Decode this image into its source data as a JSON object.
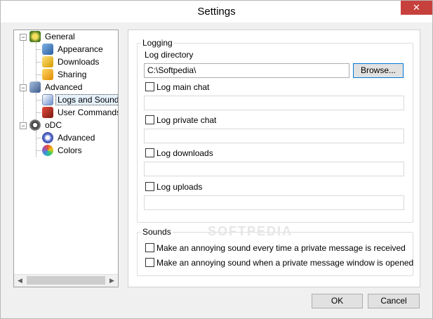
{
  "window": {
    "title": "Settings",
    "close_glyph": "✕"
  },
  "tree": {
    "items": [
      {
        "label": "General",
        "icon": "general-icon",
        "color": "#6b8e23"
      },
      {
        "label": "Appearance",
        "icon": "appearance-icon",
        "color": "#3a7bd5"
      },
      {
        "label": "Downloads",
        "icon": "downloads-icon",
        "color": "#e8b100"
      },
      {
        "label": "Sharing",
        "icon": "sharing-icon",
        "color": "#e8a000"
      },
      {
        "label": "Advanced",
        "icon": "advanced-icon",
        "color": "#4a6fa5"
      },
      {
        "label": "Logs and Sounds",
        "icon": "logs-icon",
        "color": "#3c64b4"
      },
      {
        "label": "User Commands",
        "icon": "user-commands-icon",
        "color": "#c0392b"
      },
      {
        "label": "oDC",
        "icon": "odc-icon",
        "color": "#555555"
      },
      {
        "label": "Advanced",
        "icon": "gear-icon",
        "color": "#5a6fd0"
      },
      {
        "label": "Colors",
        "icon": "colors-icon",
        "color": "#c0392b"
      }
    ],
    "selected_index": 5
  },
  "logging": {
    "legend": "Logging",
    "directory_label": "Log directory",
    "directory_value": "C:\\Softpedia\\",
    "browse_label": "Browse...",
    "log_main_chat": "Log main chat",
    "log_private_chat": "Log private chat",
    "log_downloads": "Log downloads",
    "log_uploads": "Log uploads"
  },
  "sounds": {
    "legend": "Sounds",
    "pm_received": "Make an annoying sound every time a private message is received",
    "pm_window_opened": "Make an annoying sound when a private message window is opened"
  },
  "buttons": {
    "ok": "OK",
    "cancel": "Cancel"
  },
  "watermark": "SOFTPEDIA"
}
